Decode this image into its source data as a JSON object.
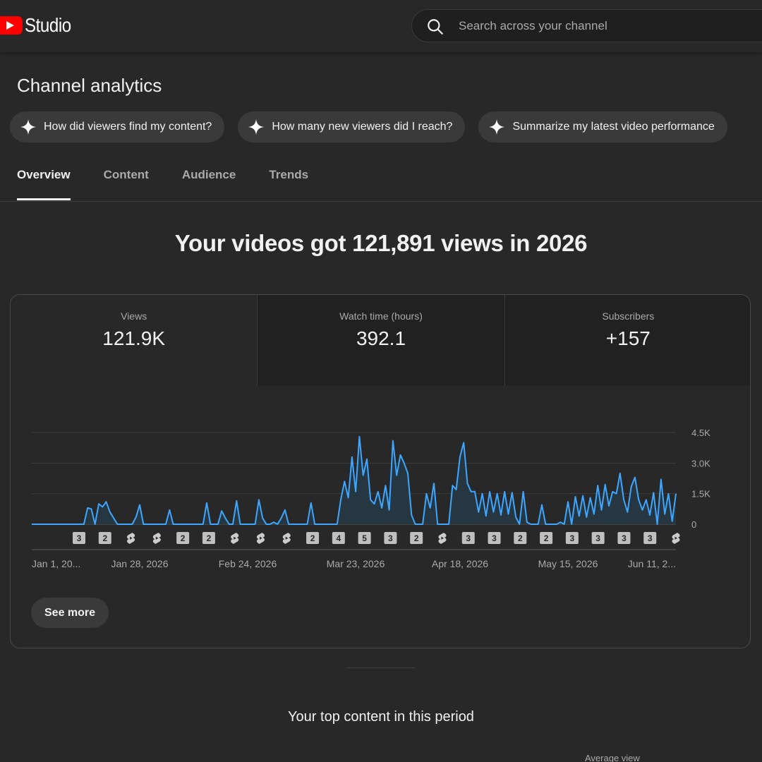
{
  "app": {
    "name": "Studio"
  },
  "search": {
    "placeholder": "Search across your channel"
  },
  "page": {
    "title": "Channel analytics",
    "headline": "Your videos got 121,891 views in 2026"
  },
  "chips": [
    {
      "label": "How did viewers find my content?",
      "icon": "sparkle-icon"
    },
    {
      "label": "How many new viewers did I reach?",
      "icon": "sparkle-icon"
    },
    {
      "label": "Summarize my latest video performance",
      "icon": "sparkle-icon"
    }
  ],
  "tabs": [
    {
      "label": "Overview",
      "active": true
    },
    {
      "label": "Content",
      "active": false
    },
    {
      "label": "Audience",
      "active": false
    },
    {
      "label": "Trends",
      "active": false
    }
  ],
  "metrics": [
    {
      "label": "Views",
      "value": "121.9K",
      "active": true
    },
    {
      "label": "Watch time (hours)",
      "value": "392.1",
      "active": false
    },
    {
      "label": "Subscribers",
      "value": "+157",
      "active": false
    }
  ],
  "chart_data": {
    "type": "area",
    "series": [
      {
        "values": [
          0,
          0,
          0,
          0,
          0,
          0,
          0,
          0,
          0,
          0,
          0,
          0,
          0,
          0,
          0,
          800,
          750,
          0,
          1000,
          850,
          1100,
          600,
          300,
          0,
          0,
          0,
          0,
          0,
          350,
          950,
          0,
          0,
          0,
          0,
          0,
          0,
          0,
          700,
          0,
          0,
          0,
          0,
          0,
          0,
          0,
          0,
          0,
          1050,
          0,
          0,
          0,
          650,
          300,
          0,
          0,
          1150,
          0,
          0,
          0,
          0,
          0,
          1200,
          300,
          0,
          0,
          100,
          0,
          300,
          700,
          0,
          0,
          0,
          0,
          0,
          0,
          1050,
          0,
          0,
          0,
          0,
          0,
          0,
          0,
          1200,
          2100,
          1300,
          3300,
          1600,
          4300,
          2400,
          3200,
          1200,
          1000,
          1600,
          800,
          1900,
          700,
          4100,
          2400,
          3400,
          3000,
          2500,
          450,
          0,
          0,
          0,
          1500,
          800,
          2000,
          0,
          0,
          0,
          0,
          1900,
          1700,
          3300,
          4000,
          2000,
          1600,
          1600,
          600,
          1500,
          400,
          1600,
          600,
          1500,
          450,
          1600,
          500,
          1550,
          350,
          0,
          1600,
          100,
          0,
          0,
          0,
          950,
          0,
          0,
          0,
          0,
          100,
          0,
          1100,
          0,
          1350,
          400,
          1400,
          350,
          1300,
          500,
          1900,
          700,
          1950,
          900,
          1600,
          1500,
          2500,
          1200,
          600,
          1850,
          2300,
          1200,
          700,
          1200,
          450,
          1550,
          0,
          2200,
          500,
          1500,
          150,
          1500
        ],
        "ylim": [
          0,
          4500
        ]
      }
    ],
    "y_ticks": [
      "4.5K",
      "3.0K",
      "1.5K",
      "0"
    ],
    "x_ticks": [
      "Jan 1, 20...",
      "Jan 28, 2026",
      "Feb 24, 2026",
      "Mar 23, 2026",
      "Apr 18, 2026",
      "May 15, 2026",
      "Jun 11, 2..."
    ],
    "markers": [
      "3",
      "2",
      "shorts",
      "shorts",
      "2",
      "2",
      "shorts",
      "shorts",
      "shorts",
      "2",
      "4",
      "5",
      "3",
      "2",
      "shorts",
      "3",
      "3",
      "2",
      "2",
      "3",
      "3",
      "3",
      "3",
      "shorts"
    ],
    "grid": true,
    "line_color": "#3ea6ff",
    "fill_color": "#263845"
  },
  "actions": {
    "see_more": "See more"
  },
  "section": {
    "top_content": "Your top content in this period",
    "avg_view": "Average view"
  }
}
